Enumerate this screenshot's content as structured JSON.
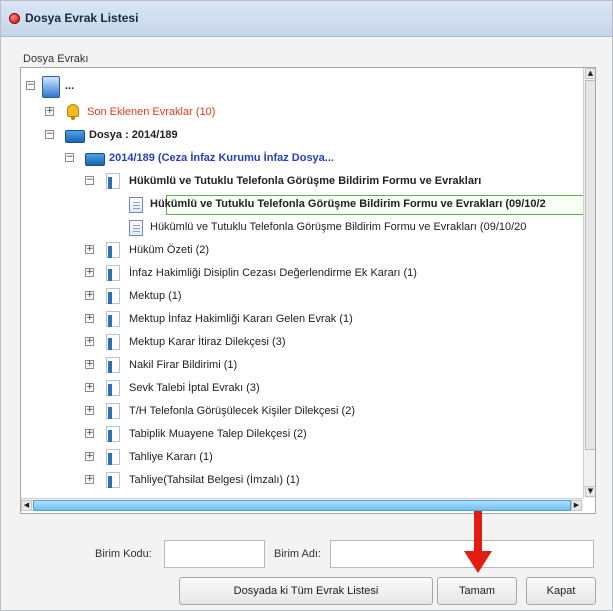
{
  "window": {
    "title": "Dosya Evrak Listesi"
  },
  "group": {
    "label": "Dosya Evrakı"
  },
  "tree": {
    "root_label": "...",
    "nodes": [
      {
        "text": "Son Eklenen Evraklar (10)",
        "expander": "⊞"
      },
      {
        "text": "Dosya : 2014/189",
        "expander": "⊟"
      },
      {
        "text": "2014/189 (Ceza İnfaz Kurumu İnfaz Dosya...",
        "expander": "⊟"
      },
      {
        "text": "Hükümlü ve Tutuklu Telefonla Görüşme Bildirim Formu ve Evrakları",
        "expander": "⊟"
      },
      {
        "text": "Hükümlü ve Tutuklu Telefonla Görüşme Bildirim Formu ve Evrakları (09/10/2"
      },
      {
        "text": "Hükümlü ve Tutuklu Telefonla Görüşme Bildirim Formu ve Evrakları (09/10/20"
      },
      {
        "text": "Hüküm Özeti (2)",
        "expander": "⊞"
      },
      {
        "text": "İnfaz Hakimliği Disiplin Cezası Değerlendirme Ek Kararı (1)",
        "expander": "⊞"
      },
      {
        "text": "Mektup (1)",
        "expander": "⊞"
      },
      {
        "text": "Mektup İnfaz Hakimliği Kararı Gelen Evrak (1)",
        "expander": "⊞"
      },
      {
        "text": "Mektup Karar İtiraz Dilekçesi (3)",
        "expander": "⊞"
      },
      {
        "text": "Nakil Firar Bildirimi (1)",
        "expander": "⊞"
      },
      {
        "text": "Sevk Talebi İptal Evrakı (3)",
        "expander": "⊞"
      },
      {
        "text": "T/H Telefonla Görüşülecek Kişiler Dilekçesi (2)",
        "expander": "⊞"
      },
      {
        "text": "Tabiplik Muayene Talep Dilekçesi (2)",
        "expander": "⊞"
      },
      {
        "text": "Tahliye Kararı (1)",
        "expander": "⊞"
      },
      {
        "text": "Tahliye(Tahsilat Belgesi (İmzalı) (1)",
        "expander": "⊞"
      }
    ]
  },
  "fields": {
    "birim_kodu_label": "Birim Kodu:",
    "birim_adi_label": "Birim Adı:"
  },
  "buttons": {
    "list_all": "Dosyada ki Tüm Evrak Listesi",
    "ok": "Tamam",
    "close": "Kapat"
  },
  "colors": {
    "accent_red": "#e03a1e",
    "link_blue": "#2640b8",
    "selection_border": "#59b24b",
    "scroll_thumb": "#6ec0f0"
  }
}
